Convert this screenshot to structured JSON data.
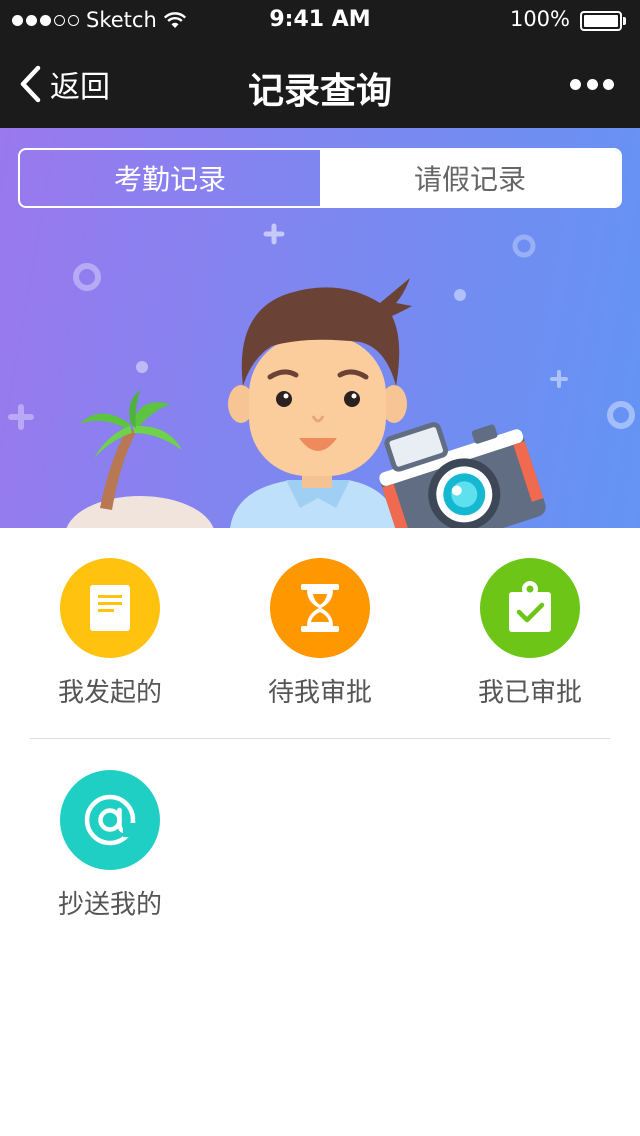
{
  "status_bar": {
    "carrier": "Sketch",
    "time": "9:41 AM",
    "battery": "100%"
  },
  "nav": {
    "back_label": "返回",
    "title": "记录查询"
  },
  "tabs": [
    {
      "label": "考勤记录",
      "active": true
    },
    {
      "label": "请假记录",
      "active": false
    }
  ],
  "grid": [
    {
      "label": "我发起的",
      "icon": "document-icon",
      "color": "#ffc20e"
    },
    {
      "label": "待我审批",
      "icon": "hourglass-icon",
      "color": "#ff9800"
    },
    {
      "label": "我已审批",
      "icon": "clipboard-check-icon",
      "color": "#6cc517"
    },
    {
      "label": "抄送我的",
      "icon": "at-icon",
      "color": "#1fcfc4"
    }
  ],
  "colors": {
    "nav_bg": "#1b1b1b",
    "banner_start": "#9a78ee",
    "banner_end": "#6394f4"
  }
}
